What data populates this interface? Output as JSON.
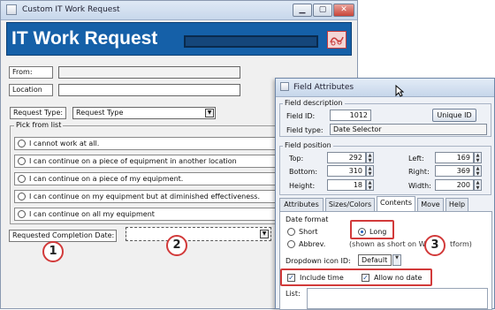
{
  "main_window": {
    "title": "Custom  IT Work Request",
    "controls": {
      "minimize": "▁",
      "restore": "▢",
      "close": "✕"
    },
    "banner_title": "IT Work Request",
    "from_label": "From:",
    "location_label": "Location",
    "request_type_label": "Request Type:",
    "request_type_value": "Request Type",
    "pick_list_label": "Pick from list",
    "options": [
      "I cannot work at all.",
      "I can continue on a piece of equipment in another location",
      "I can continue on a piece of my equipment.",
      "I can continue on my equipment but at diminished effectiveness.",
      "I can continue on all my equipment"
    ],
    "completion_date_label": "Requested Completion Date:"
  },
  "callouts": [
    "1",
    "2",
    "3"
  ],
  "dialog": {
    "title": "Field Attributes",
    "close": "✕",
    "field_description_label": "Field description",
    "field_id_label": "Field ID:",
    "field_id_value": "1012",
    "unique_id_button": "Unique ID",
    "field_type_label": "Field type:",
    "field_type_value": "Date Selector",
    "field_position_label": "Field position",
    "top_label": "Top:",
    "top_value": "292",
    "left_label": "Left:",
    "left_value": "169",
    "bottom_label": "Bottom:",
    "bottom_value": "310",
    "right_label": "Right:",
    "right_value": "369",
    "height_label": "Height:",
    "height_value": "18",
    "width_label": "Width:",
    "width_value": "200",
    "tabs": [
      "Attributes",
      "Sizes/Colors",
      "Contents",
      "Move",
      "Help"
    ],
    "date_format_label": "Date format",
    "short_label": "Short",
    "long_label": "Long",
    "abbrev_label": "Abbrev.",
    "shown_as_note": "(shown as short on Windo",
    "shown_as_note_end": "tform)",
    "dropdown_icon_label": "Dropdown icon ID:",
    "dropdown_icon_value": "Default",
    "include_time_label": "Include time",
    "allow_no_date_label": "Allow no date",
    "list_label": "List:"
  },
  "colors": {
    "banner": "#1560a8",
    "callout": "#d23a3a",
    "title_bar": "#c7d7eb"
  }
}
